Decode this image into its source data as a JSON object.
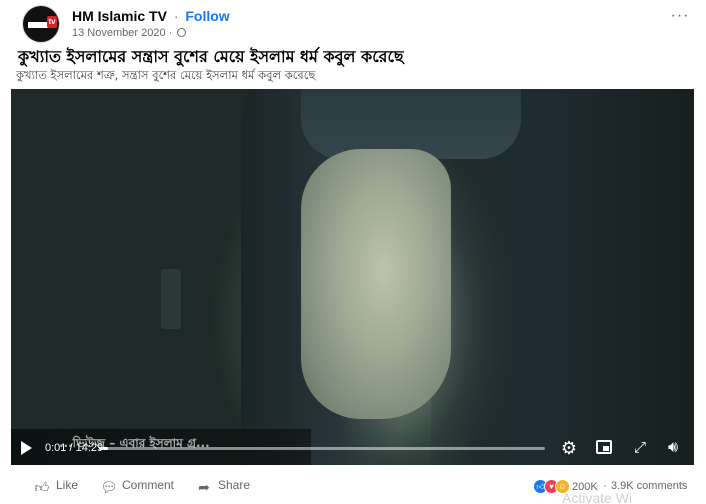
{
  "post": {
    "page_name": "HM Islamic TV",
    "separator": "·",
    "follow_label": "Follow",
    "date": "13 November 2020",
    "date_separator": "·",
    "more_label": "···",
    "headline": "কুখ্যাত ইসলামের সন্ত্রাস বুশের মেয়ে ইসলাম ধর্ম কবুল করেছে",
    "subline": "কুখ্যাত ইসলামের শত্রু, সন্ত্রাস বুশের মেয়ে ইসলাম ধর্ম কবুল করেছে"
  },
  "video": {
    "caption_text": "...ভিউজ – এবার ইসলাম গ্র...",
    "time": "0:01 / 14:29",
    "progress": 0.0012
  },
  "actions": {
    "like_label": "Like",
    "comment_label": "Comment",
    "share_label": "Share"
  },
  "stats": {
    "reactions_count": "200K",
    "comments_count": "3.9K comments"
  },
  "icons": {
    "like": "thumbs-up-icon",
    "comment": "speech-bubble-icon",
    "share": "share-arrow-icon",
    "more": "more-dots-icon",
    "globe": "globe-icon",
    "play": "play-icon",
    "settings": "gear-icon",
    "pip": "picture-in-picture-icon",
    "fullscreen": "fullscreen-icon",
    "volume": "volume-icon"
  },
  "colors": {
    "follow": "#1877f2",
    "like_reaction": "#1877f2",
    "love_reaction": "#f33e58",
    "care_reaction": "#f7b125"
  },
  "watermark": "Activate Wi"
}
